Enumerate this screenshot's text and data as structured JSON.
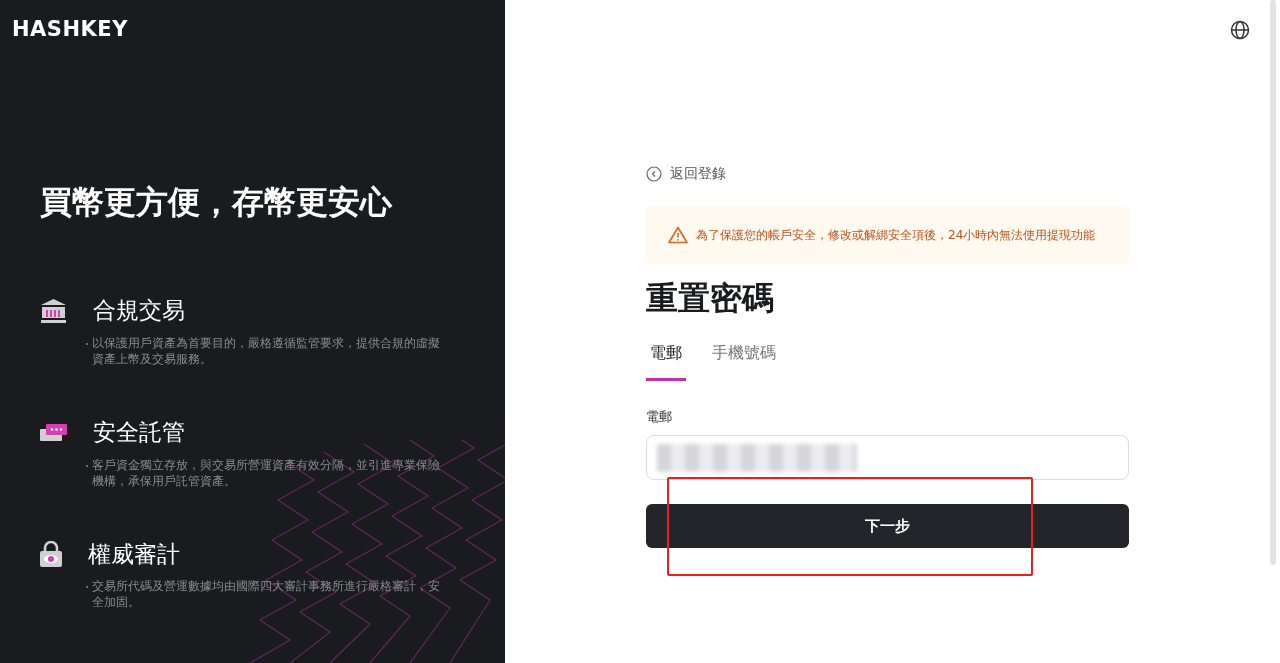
{
  "logo": "HASHKEY",
  "hero_title": "買幣更方便，存幣更安心",
  "features": [
    {
      "kind": "bank",
      "title": "合規交易",
      "description": "以保護用戶資產為首要目的，嚴格遵循監管要求，提供合規的虛擬資產上幣及交易服務。"
    },
    {
      "kind": "vault",
      "title": "安全託管",
      "description": "客戶資金獨立存放，與交易所營運資產有效分隔，並引進專業保險機構，承保用戶託管資產。"
    },
    {
      "kind": "audit",
      "title": "權威審計",
      "description": "交易所代碼及營運數據均由國際四大審計事務所進行嚴格審計，安全加固。"
    }
  ],
  "back_link": "返回登錄",
  "notice": "為了保護您的帳戶安全，修改或解綁安全項後，24小時內無法使用提現功能",
  "title": "重置密碼",
  "tabs": [
    {
      "label": "電郵",
      "selected": true
    },
    {
      "label": "手機號碼",
      "selected": false
    }
  ],
  "field": {
    "label": "電郵"
  },
  "submit": "下一步"
}
